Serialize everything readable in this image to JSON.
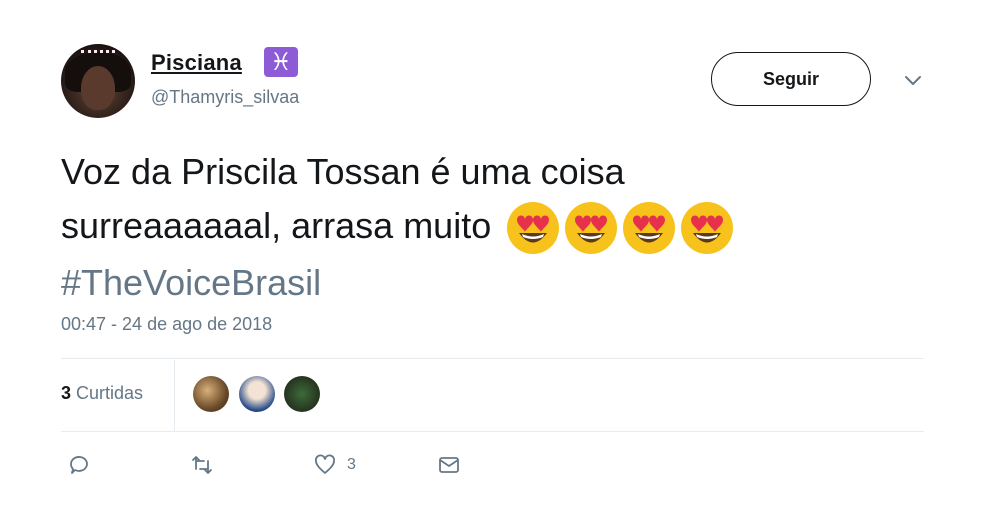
{
  "user": {
    "name": "Pisciana",
    "sign_glyph": "♓",
    "handle": "@Thamyris_silvaa"
  },
  "follow_button": {
    "label": "Seguir"
  },
  "tweet": {
    "text_line1": "Voz da Priscila Tossan é uma  coisa",
    "text_line2": "surreaaaaaal, arrasa muito",
    "emoji_names": [
      "heart-eyes-emoji",
      "heart-eyes-emoji",
      "heart-eyes-emoji",
      "heart-eyes-emoji"
    ],
    "hashtag": "#TheVoiceBrasil",
    "timestamp": "00:47 - 24 de ago de 2018"
  },
  "stats": {
    "likes_count": "3",
    "likes_label": "Curtidas"
  },
  "actions": {
    "reply_icon": "reply-icon",
    "retweet_icon": "retweet-icon",
    "like_icon": "heart-icon",
    "like_count": "3",
    "dm_icon": "envelope-icon"
  },
  "colors": {
    "text": "#14171a",
    "secondary": "#657786",
    "divider": "#e6ecf0",
    "pisces_badge": "#8e5bd6"
  }
}
